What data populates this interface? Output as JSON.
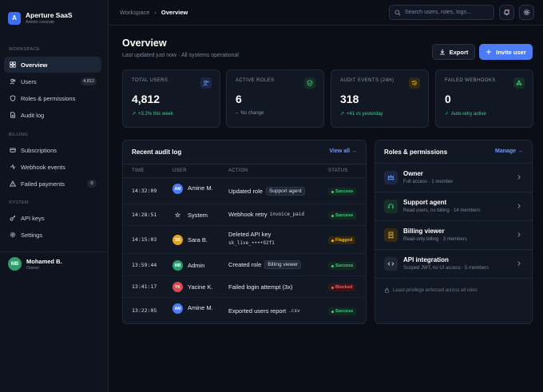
{
  "app": {
    "name": "Aperture SaaS",
    "subtitle": "Admin console",
    "logo_letter": "A",
    "accent": "#4b7cf6"
  },
  "sidebar": {
    "sections": [
      "Workspace",
      "Billing",
      "System"
    ],
    "items": [
      {
        "label": "Overview",
        "icon": "grid-icon",
        "active": true
      },
      {
        "label": "Users",
        "icon": "users-icon",
        "badge": "4,812"
      },
      {
        "label": "Roles & permissions",
        "icon": "shield-icon"
      },
      {
        "label": "Audit log",
        "icon": "file-icon"
      },
      {
        "label": "Subscriptions",
        "icon": "card-icon"
      },
      {
        "label": "Webhook events",
        "icon": "webhook-icon"
      },
      {
        "label": "Failed payments",
        "icon": "warning-icon",
        "badge": "0"
      },
      {
        "label": "API keys",
        "icon": "key-icon"
      },
      {
        "label": "Settings",
        "icon": "gear-icon"
      }
    ],
    "user": {
      "initials": "MB",
      "name": "Mohamed B.",
      "role": "Owner"
    }
  },
  "topbar": {
    "breadcrumb": [
      "Workspace",
      "Overview"
    ],
    "search_placeholder": "Search users, roles, logs..."
  },
  "header": {
    "title": "Overview",
    "subtitle": "Last updated just now · All systems operational",
    "export_label": "Export",
    "invite_label": "Invite user"
  },
  "stats": [
    {
      "label": "Total users",
      "value": "4,812",
      "trend": "+3.2% this week",
      "trend_color": "#3ecf8e",
      "icon": "user-plus-icon",
      "icon_color": "#6f98f8"
    },
    {
      "label": "Active roles",
      "value": "6",
      "trend": "No change",
      "trend_color": "#8a93a5",
      "icon": "shield-icon",
      "icon_color": "#3ecf8e"
    },
    {
      "label": "Audit events (24h)",
      "value": "318",
      "trend": "+41 vs yesterday",
      "trend_color": "#3ecf8e",
      "icon": "history-icon",
      "icon_color": "#f0b429"
    },
    {
      "label": "Failed webhooks",
      "value": "0",
      "trend": "Auto-retry active",
      "trend_color": "#3ecf8e",
      "icon": "webhook-icon",
      "icon_color": "#3ecf8e"
    }
  ],
  "audit": {
    "title": "Recent audit log",
    "view_all": "View all →",
    "columns": [
      "TIME",
      "USER",
      "ACTION",
      "STATUS"
    ],
    "rows": [
      {
        "time": "14:32:09",
        "initials": "AM",
        "user": "Amine M.",
        "avatar_color": "#4b7cf6",
        "action": "Updated role",
        "tag": "Support agent",
        "status": "Success"
      },
      {
        "time": "14:28:51",
        "initials": "",
        "user": "System",
        "avatar_color": "",
        "action": "Webhook retry",
        "code": "invoice_paid",
        "status": "Success"
      },
      {
        "time": "14:15:03",
        "initials": "SB",
        "user": "Sara B.",
        "avatar_color": "#e0a528",
        "action": "Deleted API key",
        "code2": "sk_live_••••92f1",
        "status": "Flagged"
      },
      {
        "time": "13:59:44",
        "initials": "MB",
        "user": "Admin",
        "avatar_color": "#2f9e6e",
        "action": "Created role",
        "tag": "Billing viewer",
        "status": "Success"
      },
      {
        "time": "13:41:17",
        "initials": "YK",
        "user": "Yacine K.",
        "avatar_color": "#d9474f",
        "action": "Failed login attempt (3x)",
        "status": "Blocked"
      },
      {
        "time": "13:22:05",
        "initials": "AM",
        "user": "Amine M.",
        "avatar_color": "#4b7cf6",
        "action": "Exported users report",
        "code": ".csv",
        "status": "Success"
      }
    ]
  },
  "roles": {
    "title": "Roles & permissions",
    "manage": "Manage →",
    "items": [
      {
        "name": "Owner",
        "desc": "Full access · 1 member",
        "icon": "crown-icon",
        "color": "#6f98f8",
        "bg": "#1c2744"
      },
      {
        "name": "Support agent",
        "desc": "Read users, no billing · 14 members",
        "icon": "headset-icon",
        "color": "#3ecf8e",
        "bg": "#163024"
      },
      {
        "name": "Billing viewer",
        "desc": "Read-only billing · 3 members",
        "icon": "receipt-icon",
        "color": "#f0b429",
        "bg": "#332a14"
      },
      {
        "name": "API integration",
        "desc": "Scoped JWT, no UI access · 5 members",
        "icon": "code-icon",
        "color": "#c9cfda",
        "bg": "#1f2636"
      }
    ],
    "footer": "Least-privilege enforced across all roles"
  },
  "status_colors": {
    "Success": {
      "fg": "#3ecf8e",
      "bg": "#12291f"
    },
    "Flagged": {
      "fg": "#f0b429",
      "bg": "#33280f"
    },
    "Blocked": {
      "fg": "#f0616a",
      "bg": "#361519"
    }
  }
}
